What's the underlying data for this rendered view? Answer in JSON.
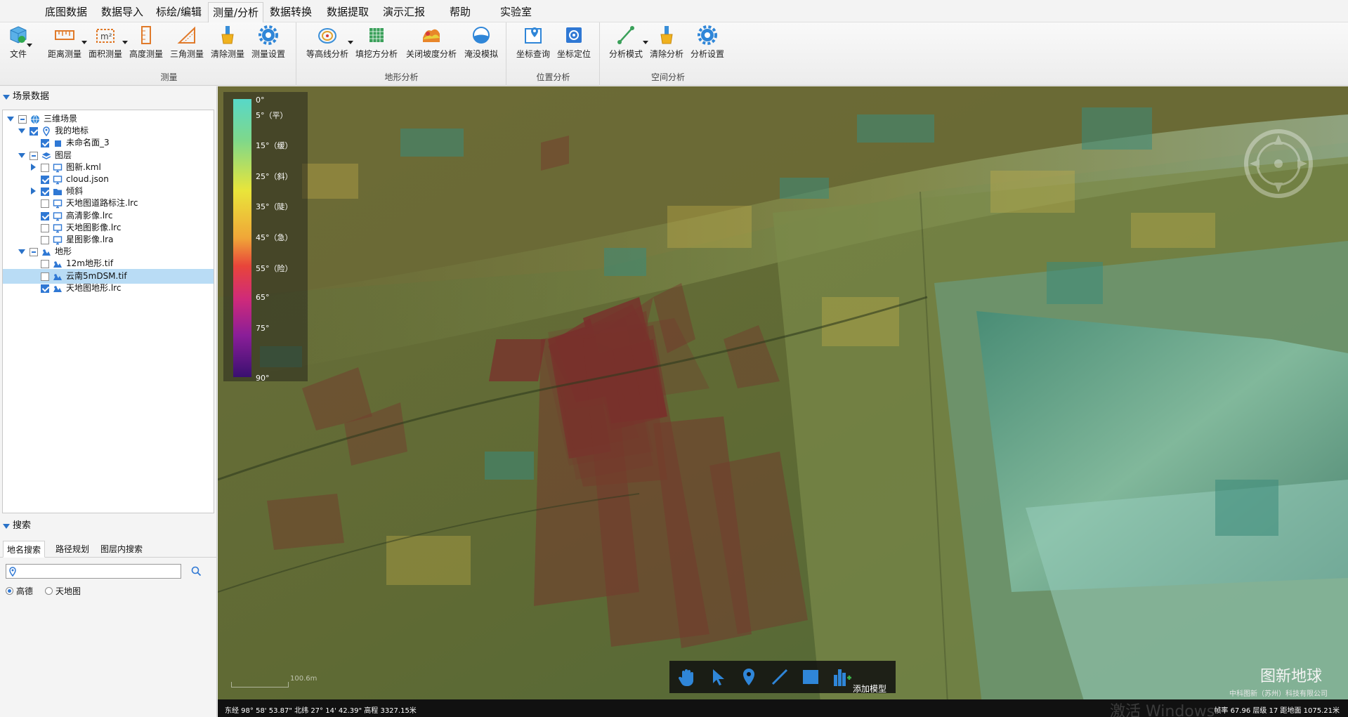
{
  "menu": {
    "items": [
      "底图数据",
      "数据导入",
      "标绘/编辑",
      "测量/分析",
      "数据转换",
      "数据提取",
      "演示汇报",
      "帮助",
      "实验室"
    ],
    "active": "测量/分析"
  },
  "ribbon": {
    "file_label": "文件",
    "groups": [
      {
        "label": "测量",
        "buttons": [
          "距离测量",
          "面积测量",
          "高度测量",
          "三角测量",
          "清除测量",
          "测量设置"
        ]
      },
      {
        "label": "地形分析",
        "buttons": [
          "等高线分析",
          "填挖方分析",
          "关闭坡度分析",
          "淹没模拟"
        ]
      },
      {
        "label": "位置分析",
        "buttons": [
          "坐标查询",
          "坐标定位"
        ]
      },
      {
        "label": "空间分析",
        "buttons": [
          "分析模式",
          "清除分析",
          "分析设置"
        ]
      }
    ]
  },
  "panel": {
    "scene_header": "场景数据",
    "search_header": "搜索",
    "tree": [
      {
        "label": "三维场景",
        "level": 0,
        "expanded": true,
        "checked": "partial",
        "icon": "globe-icon"
      },
      {
        "label": "我的地标",
        "level": 1,
        "expanded": true,
        "checked": "checked",
        "icon": "placemark-icon"
      },
      {
        "label": "未命名面_3",
        "level": 2,
        "checked": "checked",
        "icon": "polygon-icon"
      },
      {
        "label": "图层",
        "level": 1,
        "expanded": true,
        "checked": "partial",
        "icon": "layers-icon"
      },
      {
        "label": "图新.kml",
        "level": 2,
        "collapsed": true,
        "checked": "unchecked",
        "icon": "monitor-icon"
      },
      {
        "label": "cloud.json",
        "level": 2,
        "checked": "checked",
        "icon": "monitor-icon"
      },
      {
        "label": "倾斜",
        "level": 2,
        "collapsed": true,
        "checked": "checked",
        "icon": "folder-icon"
      },
      {
        "label": "天地图道路标注.lrc",
        "level": 2,
        "checked": "unchecked",
        "icon": "monitor-icon"
      },
      {
        "label": "高清影像.lrc",
        "level": 2,
        "checked": "checked",
        "icon": "monitor-icon"
      },
      {
        "label": "天地图影像.lrc",
        "level": 2,
        "checked": "unchecked",
        "icon": "monitor-icon"
      },
      {
        "label": "星图影像.lra",
        "level": 2,
        "checked": "unchecked",
        "icon": "monitor-icon"
      },
      {
        "label": "地形",
        "level": 1,
        "expanded": true,
        "checked": "partial",
        "icon": "terrain-icon"
      },
      {
        "label": "12m地形.tif",
        "level": 2,
        "checked": "unchecked",
        "icon": "terrain-icon"
      },
      {
        "label": "云南5mDSM.tif",
        "level": 2,
        "checked": "unchecked",
        "icon": "terrain-icon",
        "selected": true
      },
      {
        "label": "天地图地形.lrc",
        "level": 2,
        "checked": "checked",
        "icon": "terrain-icon"
      }
    ],
    "search_tabs": [
      "地名搜索",
      "路径规划",
      "图层内搜索"
    ],
    "search_placeholder": "",
    "radio_options": [
      "高德",
      "天地图"
    ],
    "radio_selected": "高德"
  },
  "map": {
    "legend": [
      {
        "label": "0°",
        "pos": 0.0
      },
      {
        "label": "5°（平）",
        "pos": 0.05
      },
      {
        "label": "15°（缓）",
        "pos": 0.16
      },
      {
        "label": "25°（斜）",
        "pos": 0.27
      },
      {
        "label": "35°（陡）",
        "pos": 0.38
      },
      {
        "label": "45°（急）",
        "pos": 0.49
      },
      {
        "label": "55°（险）",
        "pos": 0.6
      },
      {
        "label": "65°",
        "pos": 0.71
      },
      {
        "label": "75°",
        "pos": 0.82
      },
      {
        "label": "90°",
        "pos": 1.0
      }
    ],
    "toolbar_add_model": "添加模型",
    "brand": "图新地球",
    "company": "中科图新（苏州）科技有限公司",
    "scale_text": "100.6m",
    "status_left": "东经 98° 58' 53.87\"  北纬 27° 14' 42.39\"   高程 3327.15米",
    "status_right": "帧率 67.96   层级 17   距地面 1075.21米",
    "watermark": "激活 Windows"
  }
}
